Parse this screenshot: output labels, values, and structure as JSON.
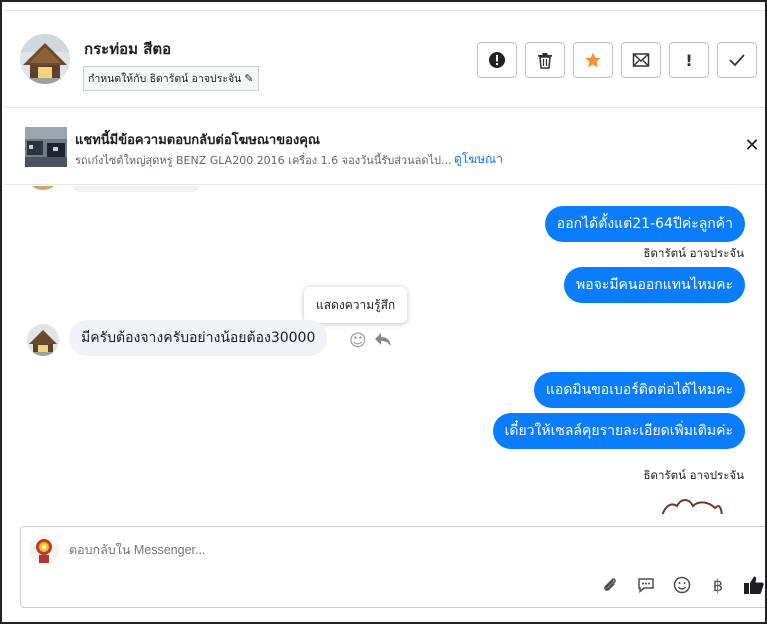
{
  "header": {
    "name": "กระท่อม สีตอ",
    "assign_label": "กำหนดให้กับ ธิดารัตน์ อาจประจัน",
    "actions": [
      "spam-icon",
      "trash-icon",
      "star-icon",
      "mark-unread-icon",
      "important-icon",
      "done-icon"
    ]
  },
  "ad": {
    "title": "แชทนี้มีข้อความตอบกลับต่อโฆษณาของคุณ",
    "description": "รถเก๋งไซต์ใหญ่สุดหรู BENZ GLA200 2016 เครื่อง 1.6 จองวันนี้รับส่วนลดไป...",
    "link": "ดูโฆษณา"
  },
  "messages": {
    "m1": "ออกได้ตั้งแต่21-64ปีค่ะลูกค้า",
    "sender1": "ธิดารัตน์ อาจประจัน",
    "m2": "พอจะมีคนออกแทนไหมคะ",
    "m3": "มีครับต้องจางครับอย่างน้อยต้อง30000",
    "tooltip": "แสดงความรู้สึก",
    "m4": "แอดมินขอเบอร์ติดต่อได้ไหมคะ",
    "m5": "เดี๋ยวให้เซลล์คุยรายละเอียดเพิ่มเติมค่ะ",
    "sender2": "ธิดารัตน์ อาจประจัน"
  },
  "composer": {
    "placeholder": "ตอบกลับใน Messenger...",
    "baht": "฿"
  },
  "colors": {
    "outgoing": "#0a7cff",
    "incoming": "#f0f2f5",
    "link": "#1877f2",
    "star": "#f7923a"
  }
}
